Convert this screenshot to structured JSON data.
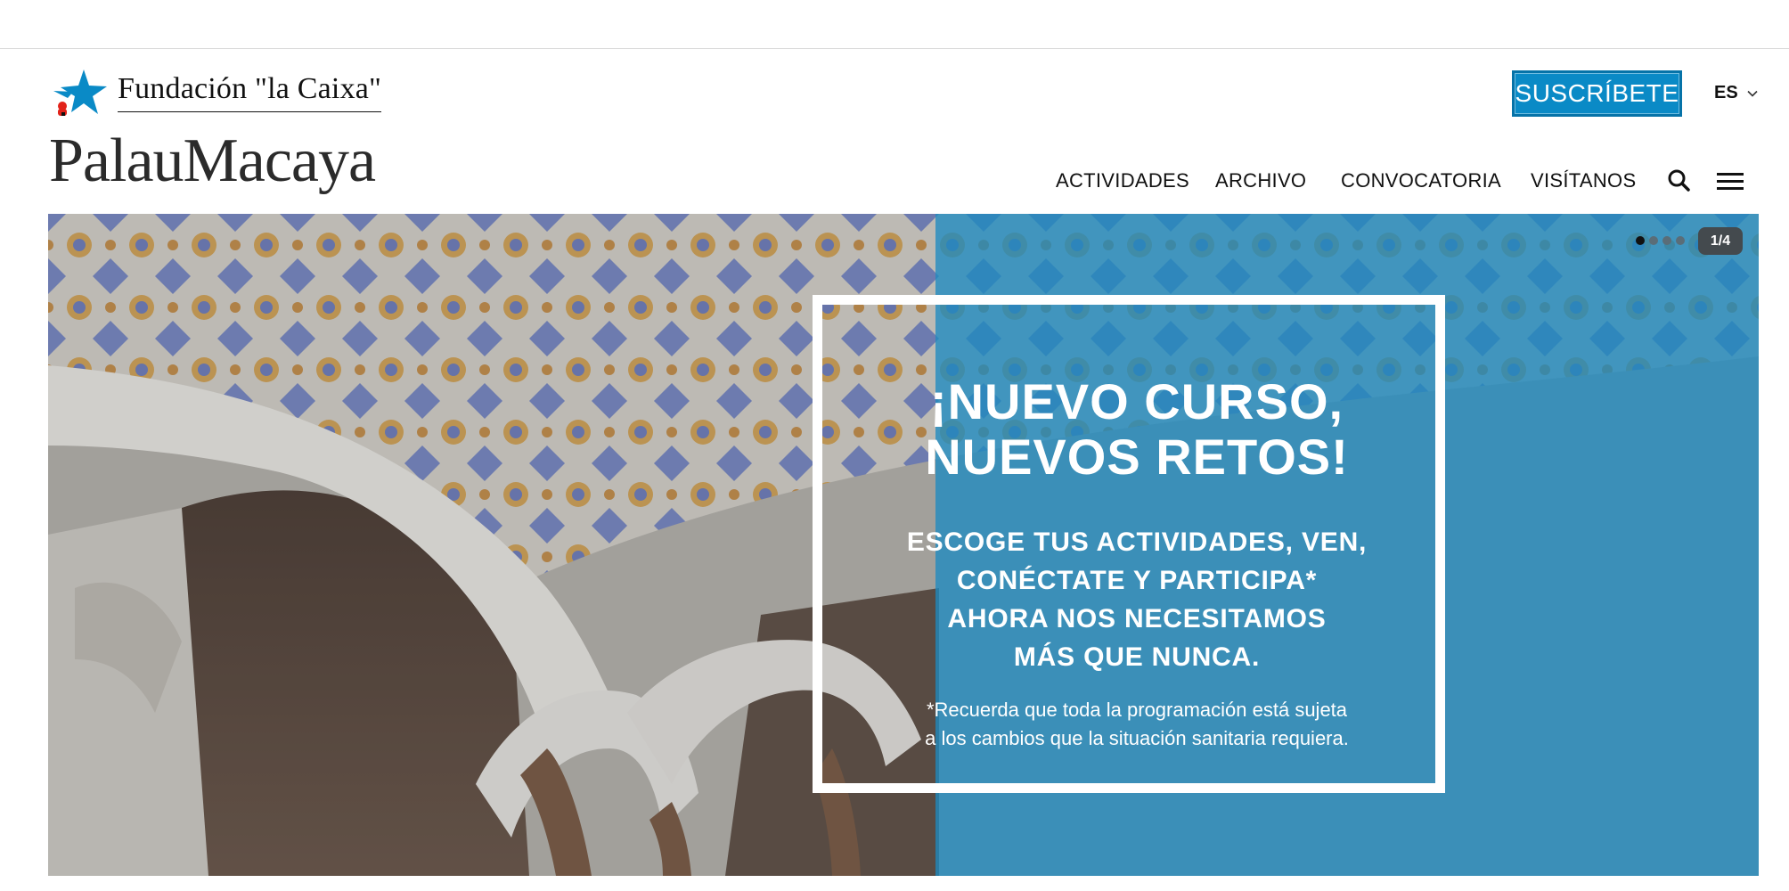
{
  "header": {
    "brand_caixa": "Fundación \"la Caixa\"",
    "brand_palau": "PalauMacaya",
    "subscribe_label": "SUSCRÍBETE",
    "language": "ES"
  },
  "nav": {
    "items": [
      {
        "label": "ACTIVIDADES"
      },
      {
        "label": "ARCHIVO"
      },
      {
        "label": "CONVOCATORIA"
      },
      {
        "label": "VISÍTANOS"
      }
    ],
    "search_icon": "search-icon",
    "menu_icon": "hamburger-menu-icon"
  },
  "hero": {
    "slide_counter": "1/4",
    "slide_total": 4,
    "active_slide": 1,
    "title_line1": "¡NUEVO CURSO,",
    "title_line2": "NUEVOS RETOS!",
    "subtitle_line1": "ESCOGE TUS ACTIVIDADES, VEN,",
    "subtitle_line2": "CONÉCTATE Y PARTICIPA*",
    "subtitle_line3": "AHORA NOS NECESITAMOS",
    "subtitle_line4": "MÁS QUE NUNCA.",
    "note_line1": "*Recuerda que toda la programación está sujeta",
    "note_line2": "a los cambios que la situación sanitaria requiera.",
    "accent_color": "#1e8ac0"
  }
}
